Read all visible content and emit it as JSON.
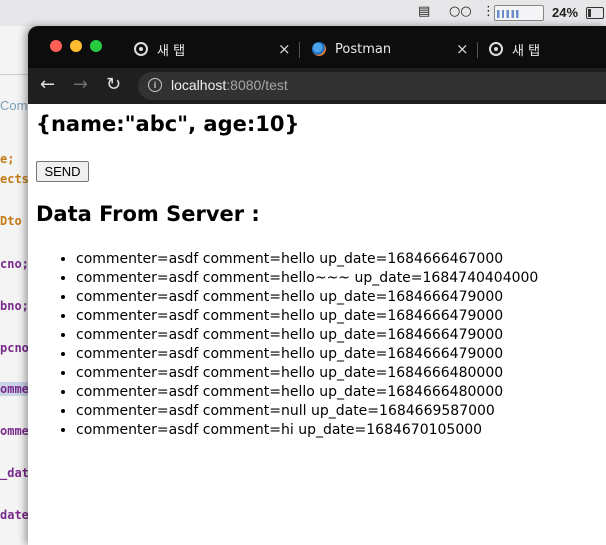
{
  "menubar": {
    "battery_percent": "24%",
    "battery_level": 0.24
  },
  "ide": {
    "fragments": [
      {
        "text": "Com",
        "color": "#7a9fb8"
      },
      {
        "text": "e;",
        "color": "#c47a14"
      },
      {
        "text": "ects",
        "color": "#c47a14"
      },
      {
        "text": "Dto",
        "color": "#c47a14"
      },
      {
        "text": "cno;",
        "color": "#7a2a8c"
      },
      {
        "text": "bno;",
        "color": "#7a2a8c"
      },
      {
        "text": "pcno",
        "color": "#7a2a8c"
      },
      {
        "text": "omme",
        "color": "#7a2a8c"
      },
      {
        "text": "omme",
        "color": "#7a2a8c"
      },
      {
        "text": "_dat",
        "color": "#7a2a8c"
      },
      {
        "text": "date",
        "color": "#7a2a8c"
      }
    ]
  },
  "browser": {
    "tabs": [
      {
        "label": "새 탭",
        "icon": "chrome-icon"
      },
      {
        "label": "Postman",
        "icon": "postman-icon"
      },
      {
        "label": "새 탭",
        "icon": "chrome-icon"
      }
    ],
    "close_glyph": "×",
    "nav": {
      "back": "←",
      "forward": "→",
      "reload": "↻"
    },
    "url": {
      "host": "localhost",
      "rest": ":8080/test"
    }
  },
  "page": {
    "json_text": "{name:\"abc\", age:10}",
    "send_label": "SEND",
    "heading": "Data From Server :",
    "comments": [
      "commenter=asdf comment=hello up_date=1684666467000",
      "commenter=asdf comment=hello~~~ up_date=1684740404000",
      "commenter=asdf comment=hello up_date=1684666479000",
      "commenter=asdf comment=hello up_date=1684666479000",
      "commenter=asdf comment=hello up_date=1684666479000",
      "commenter=asdf comment=hello up_date=1684666479000",
      "commenter=asdf comment=hello up_date=1684666480000",
      "commenter=asdf comment=hello up_date=1684666480000",
      "commenter=asdf comment=null up_date=1684669587000",
      "commenter=asdf comment=hi up_date=1684670105000"
    ]
  }
}
